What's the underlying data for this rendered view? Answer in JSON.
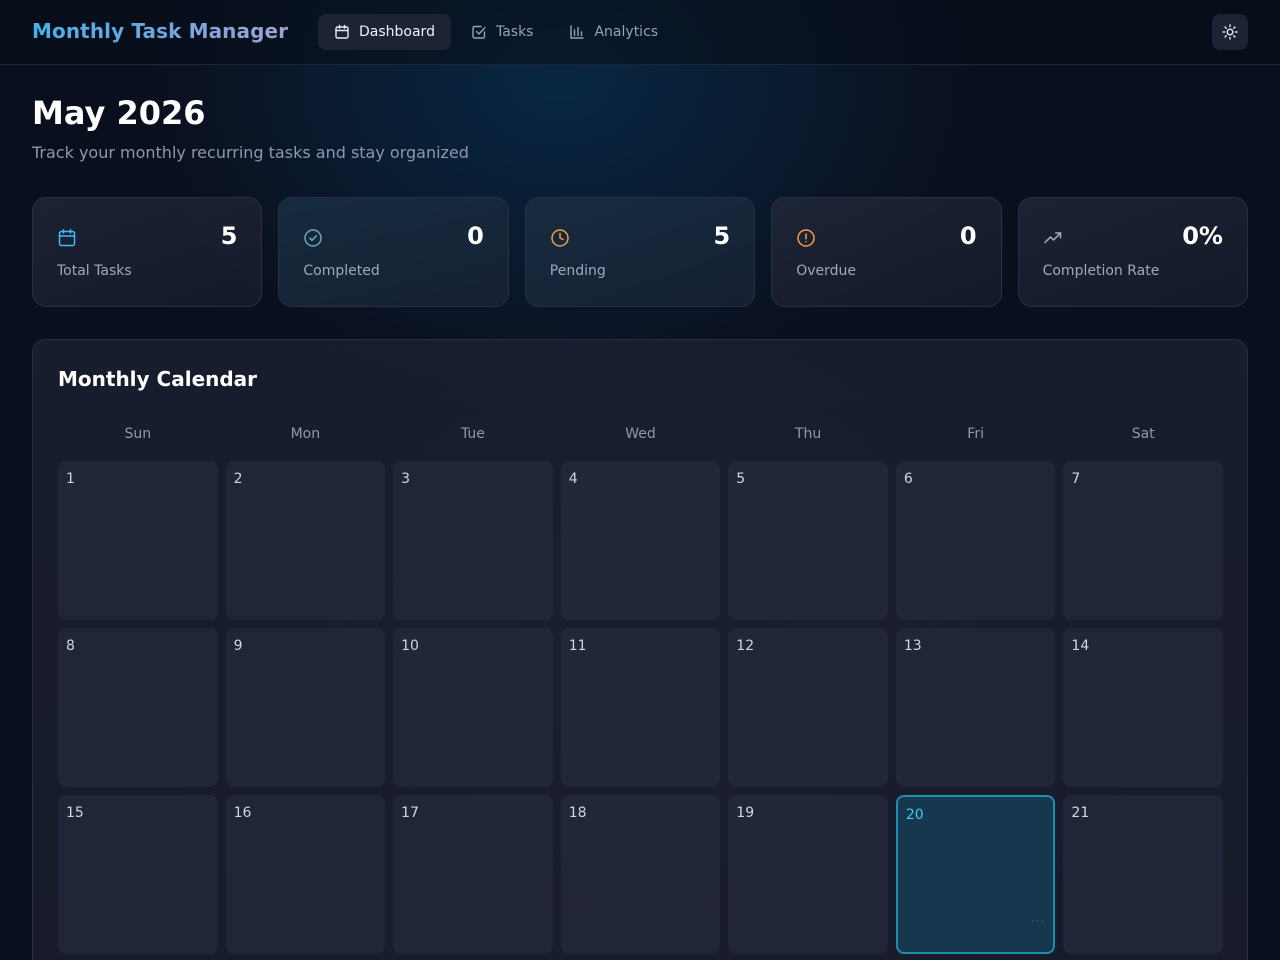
{
  "app": {
    "title": "Monthly Task Manager"
  },
  "nav": {
    "items": [
      {
        "label": "Dashboard",
        "icon": "calendar-icon",
        "active": true
      },
      {
        "label": "Tasks",
        "icon": "checkbox-icon",
        "active": false
      },
      {
        "label": "Analytics",
        "icon": "bar-chart-icon",
        "active": false
      }
    ],
    "theme_toggle_icon": "sun-icon"
  },
  "header": {
    "title": "May 2026",
    "subtitle": "Track your monthly recurring tasks and stay organized"
  },
  "stats": [
    {
      "value": "5",
      "label": "Total Tasks",
      "icon": "calendar-icon",
      "color": "#38bdf8"
    },
    {
      "value": "0",
      "label": "Completed",
      "icon": "check-circle-icon",
      "color": "#6fa8b8"
    },
    {
      "value": "5",
      "label": "Pending",
      "icon": "clock-icon",
      "color": "#f59e42"
    },
    {
      "value": "0",
      "label": "Overdue",
      "icon": "alert-circle-icon",
      "color": "#f59e42"
    },
    {
      "value": "0%",
      "label": "Completion Rate",
      "icon": "trending-up-icon",
      "color": "#a7b0c8"
    }
  ],
  "calendar": {
    "title": "Monthly Calendar",
    "weekdays": [
      "Sun",
      "Mon",
      "Tue",
      "Wed",
      "Thu",
      "Fri",
      "Sat"
    ],
    "days": [
      "1",
      "2",
      "3",
      "4",
      "5",
      "6",
      "7",
      "8",
      "9",
      "10",
      "11",
      "12",
      "13",
      "14",
      "15",
      "16",
      "17",
      "18",
      "19",
      "20",
      "21"
    ],
    "today": "20",
    "today_dots": "···"
  },
  "colors": {
    "background": "#0a0f1d",
    "accent": "#38bdf8",
    "today_border": "#1a8fb0",
    "today_fill": "#15384f"
  }
}
